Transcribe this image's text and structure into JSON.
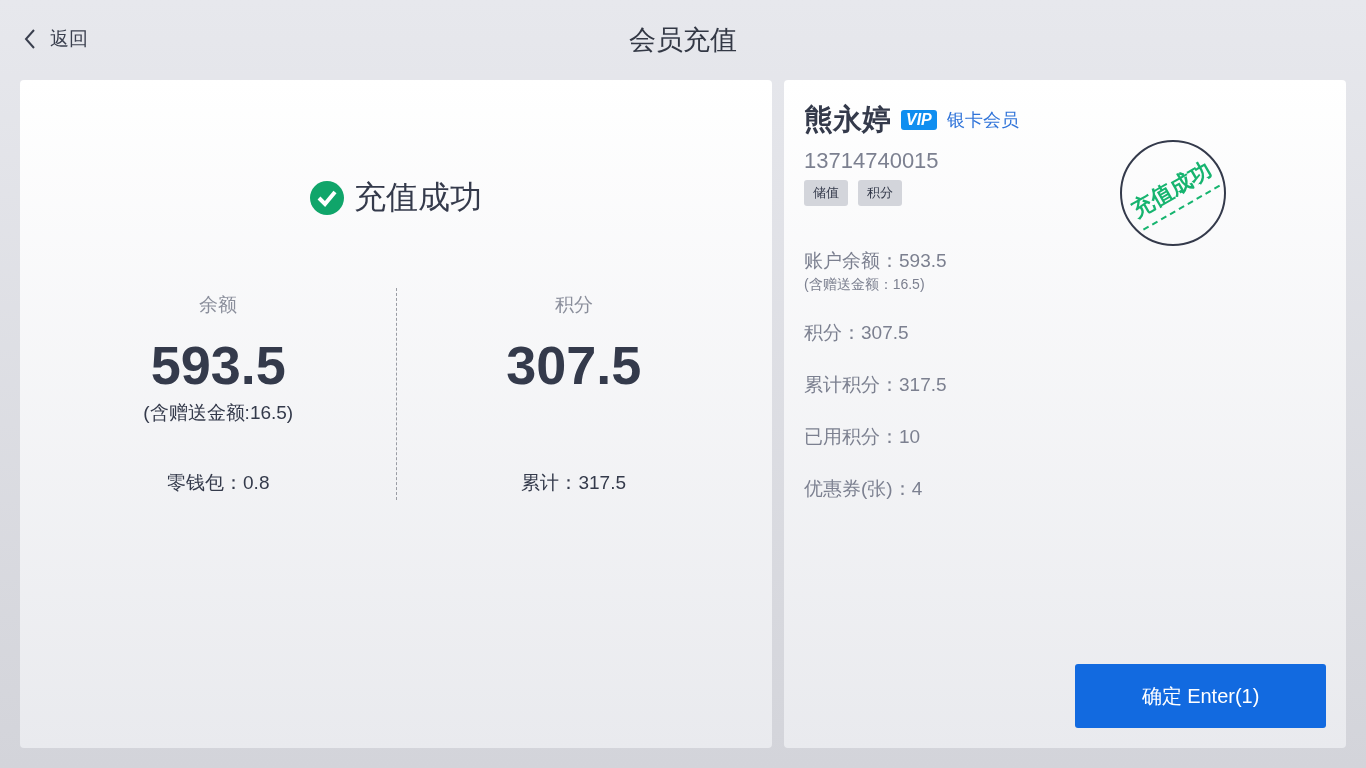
{
  "header": {
    "back": "返回",
    "title": "会员充值"
  },
  "result": {
    "title": "充值成功",
    "columns": [
      {
        "label": "余额",
        "value": "593.5",
        "note": "(含赠送金额:16.5)",
        "footer": "零钱包：0.8"
      },
      {
        "label": "积分",
        "value": "307.5",
        "footer": "累计：317.5"
      }
    ]
  },
  "member": {
    "name": "熊永婷",
    "vip": "VIP",
    "level": "银卡会员",
    "phone": "13714740015",
    "tags": [
      "储值",
      "积分"
    ],
    "stamp": "充值成功",
    "balance": "账户余额：593.5",
    "balance_note": "(含赠送金额：16.5)",
    "stats": [
      "积分：307.5",
      "累计积分：317.5",
      "已用积分：10",
      "优惠券(张)：4"
    ]
  },
  "confirm": "确定 Enter(1)"
}
